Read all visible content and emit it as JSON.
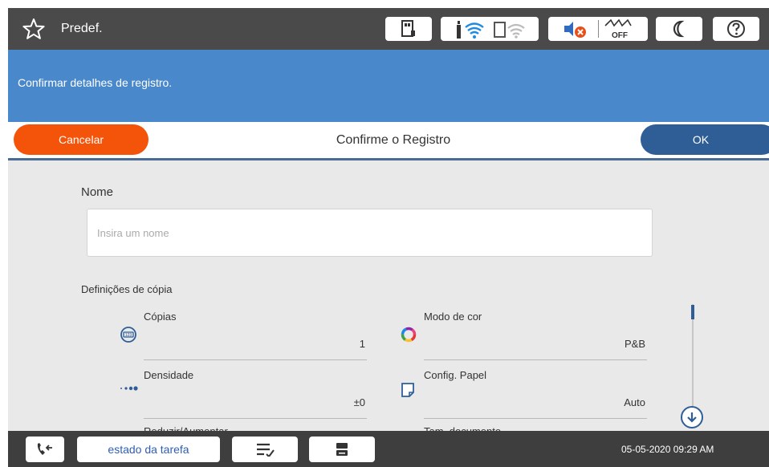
{
  "statusbar": {
    "preset_label": "Predef.",
    "icons": [
      "star-icon",
      "memory-device-icon",
      "wifi-icon",
      "wifi-direct-icon",
      "fax-muted-icon",
      "network-off-icon",
      "sleep-moon-icon",
      "help-icon"
    ],
    "network_off_text": "OFF"
  },
  "message": "Confirmar detalhes de registro.",
  "actionbar": {
    "cancel_label": "Cancelar",
    "title": "Confirme o Registro",
    "ok_label": "OK"
  },
  "form": {
    "name_label": "Nome",
    "name_placeholder": "Insira um nome",
    "name_value": "",
    "copy_settings_label": "Definições de cópia"
  },
  "settings": [
    {
      "label": "Cópias",
      "value": "1",
      "icon": "copies-icon"
    },
    {
      "label": "Modo de cor",
      "value": "P&B",
      "icon": "color-mode-icon"
    },
    {
      "label": "Densidade",
      "value": "±0",
      "icon": "density-icon"
    },
    {
      "label": "Config. Papel",
      "value": "Auto",
      "icon": "paper-settings-icon"
    },
    {
      "label": "Reduzir/Aumentar",
      "value": "",
      "icon": ""
    },
    {
      "label": "Tam. documento",
      "value": "",
      "icon": ""
    }
  ],
  "bottombar": {
    "task_status_label": "estado da tarefa",
    "datetime": "05-05-2020 09:29 AM"
  },
  "colors": {
    "topbar": "#4a4a4a",
    "message_bar": "#4a88cc",
    "cancel": "#f4540a",
    "ok": "#2f5e97",
    "content_bg": "#e9e9e9",
    "bottombar": "#3e3e3e"
  }
}
